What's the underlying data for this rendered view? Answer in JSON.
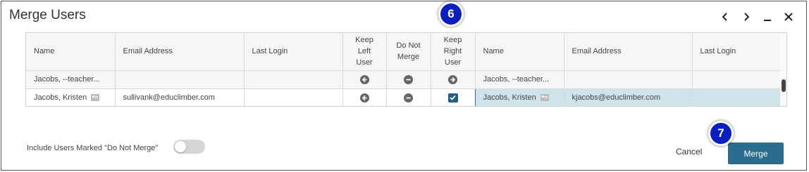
{
  "dialog": {
    "title": "Merge Users"
  },
  "window_controls": {
    "prev_icon": "chevron-left-icon",
    "next_icon": "chevron-right-icon",
    "minimize_icon": "minimize-icon",
    "close_icon": "close-icon"
  },
  "table": {
    "headers": {
      "left_name": "Name",
      "left_email": "Email Address",
      "left_last_login": "Last Login",
      "keep_left_line1": "Keep",
      "keep_left_line2": "Left",
      "keep_left_line3": "User",
      "do_not_merge_line1": "Do Not",
      "do_not_merge_line2": "Merge",
      "keep_right_line1": "Keep",
      "keep_right_line2": "Right",
      "keep_right_line3": "User",
      "right_name": "Name",
      "right_email": "Email Address",
      "right_last_login": "Last Login"
    },
    "rows": [
      {
        "left_name": "Jacobs, --teacher...",
        "left_email": "",
        "left_last_login": "",
        "right_name": "Jacobs, --teacher...",
        "right_email": "",
        "right_last_login": "",
        "selected_action": "none"
      },
      {
        "left_name": "Jacobs, Kristen",
        "left_email": "sullivank@educlimber.com",
        "left_last_login": "",
        "right_name": "Jacobs, Kristen",
        "right_email": "kjacobs@educlimber.com",
        "right_last_login": "",
        "selected_action": "keep_right"
      }
    ]
  },
  "callouts": {
    "step6": "6",
    "step7": "7"
  },
  "footer": {
    "toggle_label": "Include Users Marked \"Do Not Merge\"",
    "toggle_on": false,
    "cancel_label": "Cancel",
    "merge_label": "Merge"
  },
  "colors": {
    "accent": "#2a6d8c",
    "selected_row": "#cfe4ea",
    "callout": "#0a1fbf"
  }
}
